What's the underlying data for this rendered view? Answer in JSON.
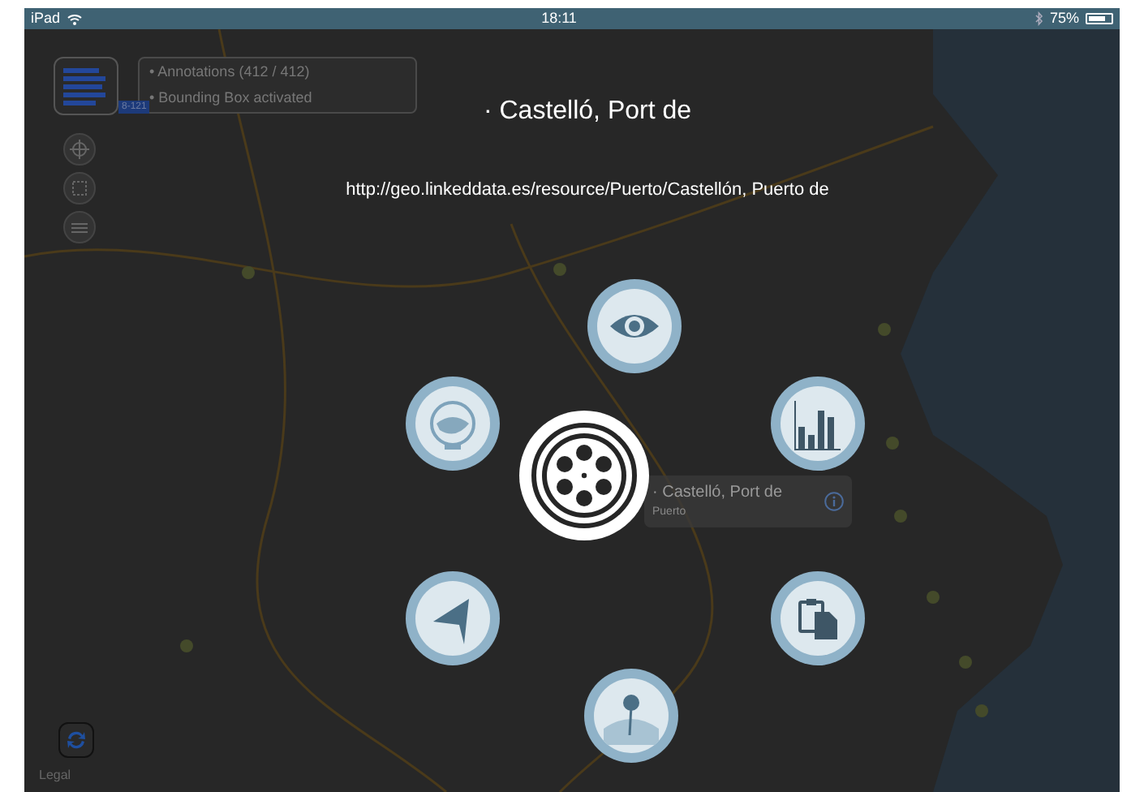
{
  "status_bar": {
    "device": "iPad",
    "time": "18:11",
    "battery": "75%"
  },
  "menu_button": {
    "badge": "8-121"
  },
  "info_panel": {
    "lines": [
      "• Annotations (412 / 412)",
      "• Bounding Box activated"
    ]
  },
  "map_tools": [
    {
      "kind": "locate"
    },
    {
      "kind": "select"
    },
    {
      "kind": "layers"
    }
  ],
  "title": "· Castelló, Port de",
  "uri": "http://geo.linkeddata.es/resource/Puerto/Castellón, Puerto de",
  "callout": {
    "title": "· Castelló, Port de",
    "subtitle": "Puerto"
  },
  "radial_menu": [
    {
      "kind": "eye"
    },
    {
      "kind": "chart"
    },
    {
      "kind": "clipboard"
    },
    {
      "kind": "pin"
    },
    {
      "kind": "navigate"
    },
    {
      "kind": "globe"
    }
  ],
  "legal": "Legal"
}
